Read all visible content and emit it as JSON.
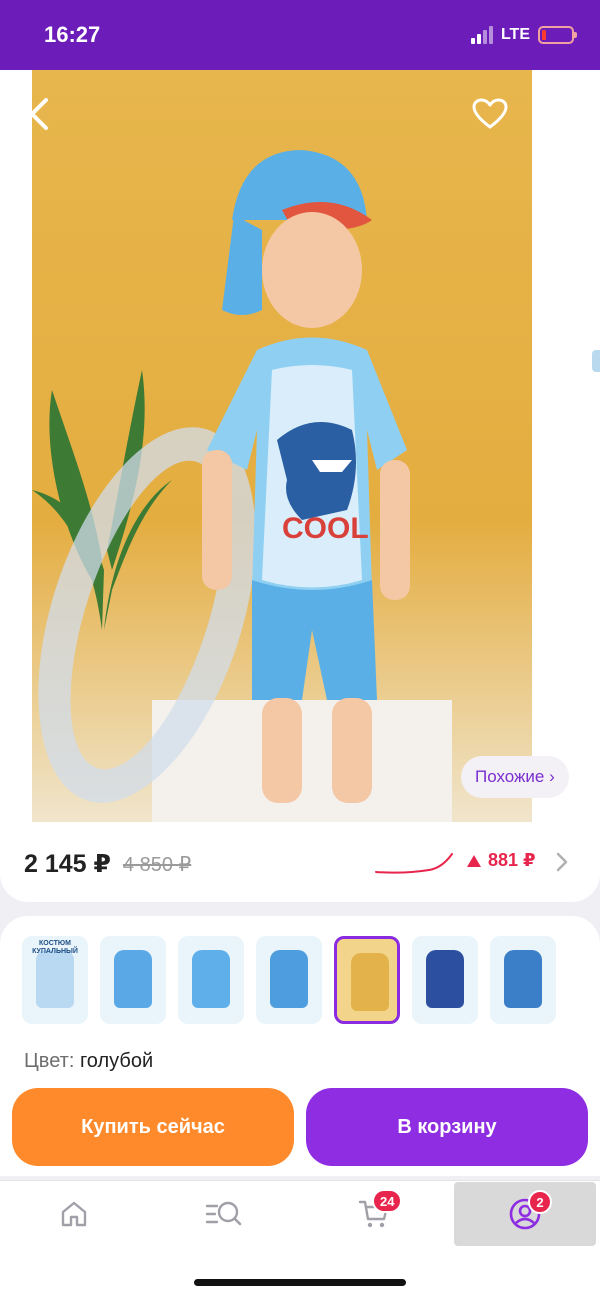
{
  "status_bar": {
    "time": "16:27",
    "network": "LTE"
  },
  "product": {
    "image_print_text": "COOL",
    "similar_label": "Похожие ›",
    "price_current": "2 145 ₽",
    "price_old": "4 850 ₽",
    "price_change": "881 ₽",
    "color_label": "Цвет:",
    "color_value": "голубой"
  },
  "variants": [
    {
      "name": "variant-1",
      "label": "КОСТЮМ КУПАЛЬНЫЙ",
      "color": "#b9d9f2"
    },
    {
      "name": "variant-2",
      "color": "#5aa8e6"
    },
    {
      "name": "variant-3",
      "color": "#5fb0ea"
    },
    {
      "name": "variant-4",
      "color": "#4d9ddf"
    },
    {
      "name": "variant-5",
      "color": "#e3b24a",
      "selected": true
    },
    {
      "name": "variant-6",
      "color": "#2d4fa0"
    },
    {
      "name": "variant-7",
      "color": "#3a7fc7"
    }
  ],
  "actions": {
    "buy_now": "Купить сейчас",
    "add_to_cart": "В корзину"
  },
  "tabbar": {
    "cart_count": "24",
    "profile_count": "2"
  },
  "colors": {
    "accent": "#8e2de2",
    "buy": "#ff8a2b",
    "status_bar": "#6c1cb8",
    "price_up": "#e8264d"
  }
}
